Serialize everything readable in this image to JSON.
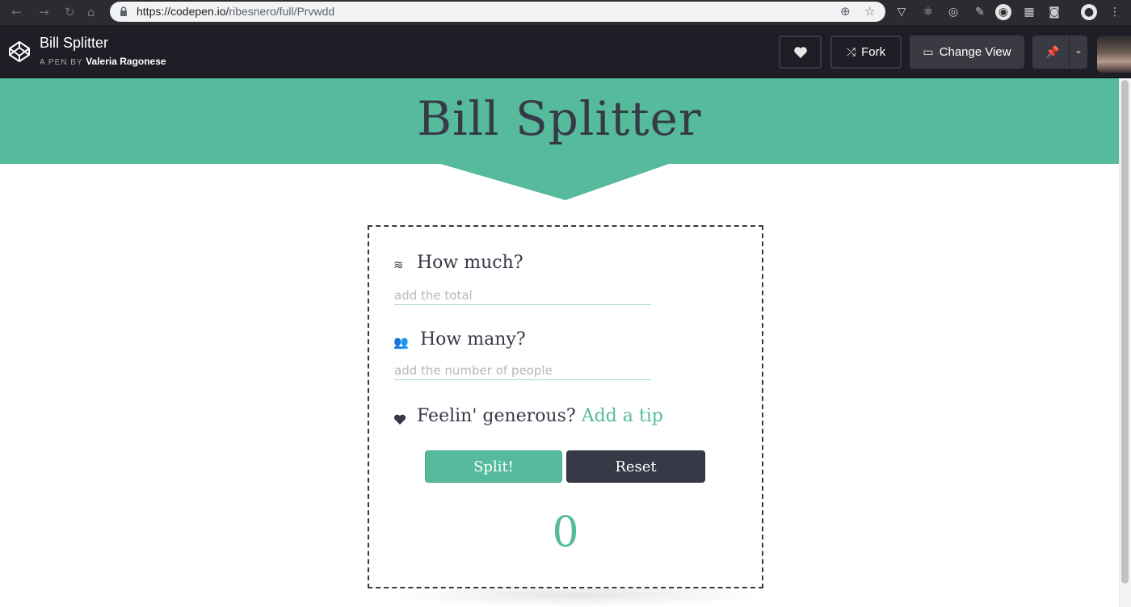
{
  "browser": {
    "url_host": "https://codepen.io/",
    "url_path": "ribesnero/full/Prvwdd"
  },
  "codepen": {
    "pen_title": "Bill Splitter",
    "byline_prefix": "A PEN BY",
    "author": "Valeria Ragonese",
    "buttons": {
      "fork": "Fork",
      "change_view": "Change View"
    }
  },
  "app": {
    "title": "Bill Splitter",
    "how_much_label": "How much?",
    "total_placeholder": "add the total",
    "how_many_label": "How many?",
    "people_placeholder": "add the number of people",
    "generous_label": "Feelin' generous?",
    "tip_link": "Add a tip",
    "split_button": "Split!",
    "reset_button": "Reset",
    "result": "0"
  },
  "colors": {
    "accent": "#55bb9c",
    "dark": "#363a47",
    "header": "#1e1f26"
  }
}
